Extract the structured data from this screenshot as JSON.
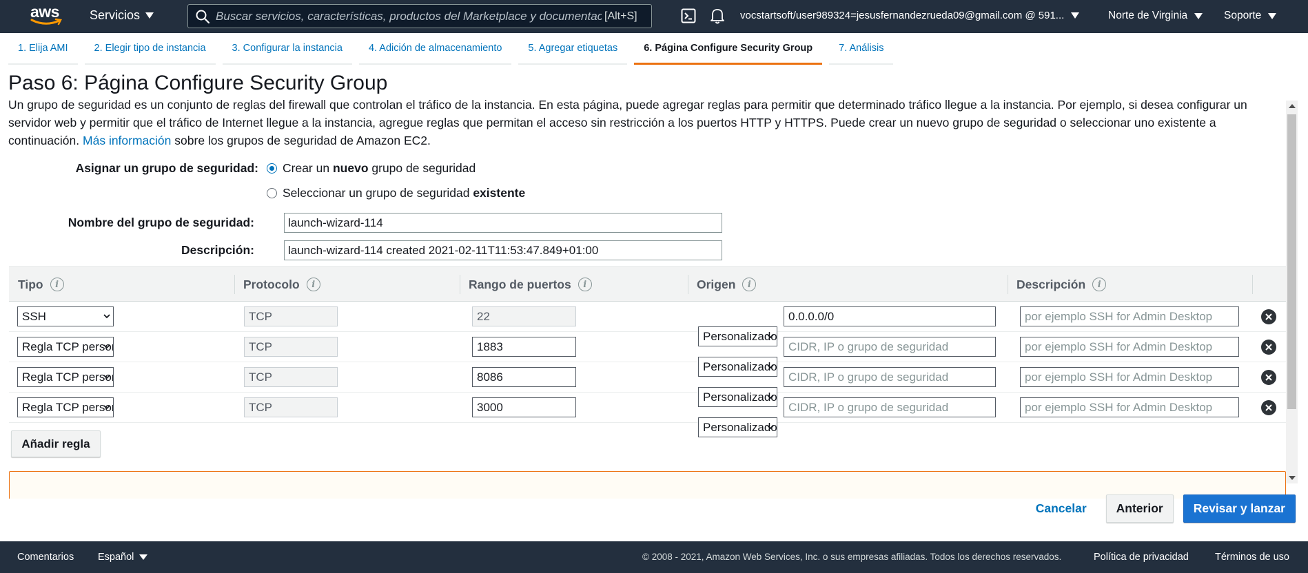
{
  "topbar": {
    "logo_text": "aws",
    "services_label": "Servicios",
    "search_placeholder": "Buscar servicios, características, productos del Marketplace y documentación",
    "search_shortcut": "[Alt+S]",
    "account": "vocstartsoft/user989324=jesusfernandezrueda09@gmail.com @ 591...",
    "region": "Norte de Virginia",
    "support": "Soporte"
  },
  "steps": [
    {
      "label": "1. Elija AMI",
      "active": false
    },
    {
      "label": "2. Elegir tipo de instancia",
      "active": false
    },
    {
      "label": "3. Configurar la instancia",
      "active": false
    },
    {
      "label": "4. Adición de almacenamiento",
      "active": false
    },
    {
      "label": "5. Agregar etiquetas",
      "active": false
    },
    {
      "label": "6. Página Configure Security Group",
      "active": true
    },
    {
      "label": "7. Análisis",
      "active": false
    }
  ],
  "page": {
    "title": "Paso 6: Página Configure Security Group",
    "intro": "Un grupo de seguridad es un conjunto de reglas del firewall que controlan el tráfico de la instancia. En esta página, puede agregar reglas para permitir que determinado tráfico llegue a la instancia. Por ejemplo, si desea configurar un servidor web y permitir que el tráfico de Internet llegue a la instancia, agregue reglas que permitan el acceso sin restricción a los puertos HTTP y HTTPS. Puede crear un nuevo grupo de seguridad o seleccionar uno existente a continuación.",
    "more_info_link": "Más información",
    "intro_tail": "sobre los grupos de seguridad de Amazon EC2."
  },
  "form": {
    "assign_label": "Asignar un grupo de seguridad:",
    "option_new_pre": "Crear un",
    "option_new_bold": "nuevo",
    "option_new_post": "grupo de seguridad",
    "option_existing_pre": "Seleccionar un grupo de seguridad",
    "option_existing_bold": "existente",
    "selected_option": "new",
    "name_label": "Nombre del grupo de seguridad:",
    "name_value": "launch-wizard-114",
    "desc_label": "Descripción:",
    "desc_value": "launch-wizard-114 created 2021-02-11T11:53:47.849+01:00"
  },
  "table": {
    "headers": [
      "Tipo",
      "Protocolo",
      "Rango de puertos",
      "Origen",
      "Descripción"
    ],
    "rows": [
      {
        "type": "SSH",
        "protocol": "TCP",
        "port": "22",
        "port_editable": false,
        "source_mode": "Personalizado",
        "source": "0.0.0.0/0",
        "source_placeholder": "",
        "description": "",
        "description_placeholder": "por ejemplo SSH for Admin Desktop"
      },
      {
        "type": "Regla TCP personalizada",
        "protocol": "TCP",
        "port": "1883",
        "port_editable": true,
        "source_mode": "Personalizado",
        "source": "",
        "source_placeholder": "CIDR, IP o grupo de seguridad",
        "description": "",
        "description_placeholder": "por ejemplo SSH for Admin Desktop"
      },
      {
        "type": "Regla TCP personalizada",
        "protocol": "TCP",
        "port": "8086",
        "port_editable": true,
        "source_mode": "Personalizado",
        "source": "",
        "source_placeholder": "CIDR, IP o grupo de seguridad",
        "description": "",
        "description_placeholder": "por ejemplo SSH for Admin Desktop"
      },
      {
        "type": "Regla TCP personalizada",
        "protocol": "TCP",
        "port": "3000",
        "port_editable": true,
        "source_mode": "Personalizado",
        "source": "",
        "source_placeholder": "CIDR, IP o grupo de seguridad",
        "description": "",
        "description_placeholder": "por ejemplo SSH for Admin Desktop"
      }
    ],
    "add_rule_label": "Añadir regla"
  },
  "actions": {
    "cancel": "Cancelar",
    "previous": "Anterior",
    "review": "Revisar y lanzar"
  },
  "footer": {
    "feedback": "Comentarios",
    "language": "Español",
    "copyright": "© 2008 - 2021, Amazon Web Services, Inc. o sus empresas afiliadas. Todos los derechos reservados.",
    "privacy": "Política de privacidad",
    "terms": "Términos de uso"
  },
  "colors": {
    "nav_bg": "#232f3e",
    "accent_orange": "#ec7211",
    "link_blue": "#0073bb",
    "primary_button": "#1a73d2"
  },
  "icons": [
    "search-icon",
    "cloudshell-icon",
    "bell-icon",
    "info-icon",
    "chevron-down-icon",
    "remove-icon"
  ]
}
